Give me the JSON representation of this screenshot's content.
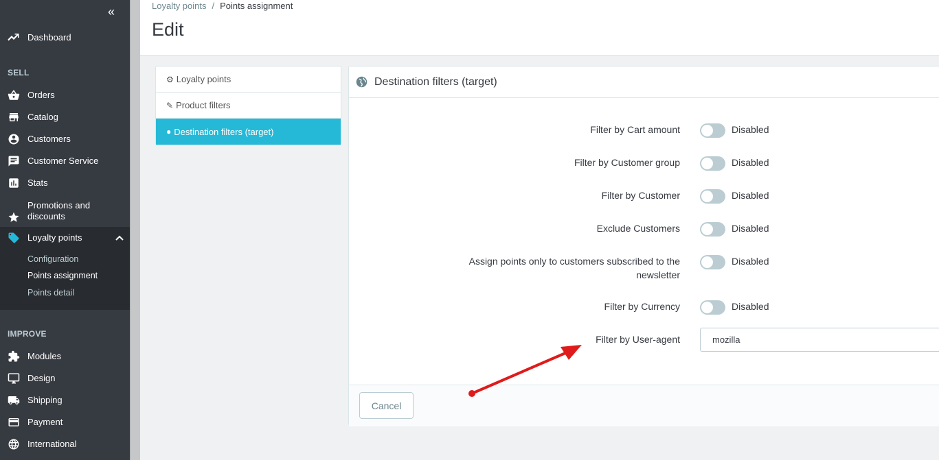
{
  "sidebar": {
    "collapse_icon": "double-chevron-left-icon",
    "dashboard": "Dashboard",
    "sell_title": "SELL",
    "orders": "Orders",
    "catalog": "Catalog",
    "customers": "Customers",
    "customer_service": "Customer Service",
    "stats": "Stats",
    "promotions_line1": "Promotions and",
    "promotions_line2": "discounts",
    "loyalty_points": "Loyalty points",
    "sub": {
      "configuration": "Configuration",
      "points_assignment": "Points assignment",
      "points_detail": "Points detail"
    },
    "improve_title": "IMPROVE",
    "modules": "Modules",
    "design": "Design",
    "shipping": "Shipping",
    "payment": "Payment",
    "international": "International"
  },
  "header": {
    "breadcrumb_parent": "Loyalty points",
    "breadcrumb_sep": "/",
    "breadcrumb_current": "Points assignment",
    "title": "Edit"
  },
  "tabs": {
    "loyalty_points": "Loyalty points",
    "product_filters": "Product filters",
    "destination_filters": "Destination filters (target)"
  },
  "panel": {
    "title": "Destination filters (target)",
    "rows": {
      "cart_amount": {
        "label": "Filter by Cart amount",
        "state": "Disabled"
      },
      "customer_group": {
        "label": "Filter by Customer group",
        "state": "Disabled"
      },
      "customer": {
        "label": "Filter by Customer",
        "state": "Disabled"
      },
      "exclude_customers": {
        "label": "Exclude Customers",
        "state": "Disabled"
      },
      "newsletter": {
        "label_line1": "Assign points only to customers subscribed to the",
        "label_line2": "newsletter",
        "state": "Disabled"
      },
      "currency": {
        "label": "Filter by Currency",
        "state": "Disabled"
      },
      "user_agent": {
        "label": "Filter by User-agent",
        "value": "mozilla"
      }
    },
    "cancel": "Cancel"
  },
  "colors": {
    "sidebar_bg": "#363a41",
    "active_tab": "#25b9d7",
    "loyalty_icon": "#25b9d7",
    "arrow": "#e01b1b"
  }
}
